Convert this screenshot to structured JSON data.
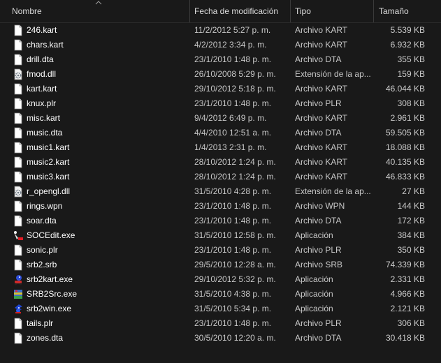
{
  "columns": {
    "name": "Nombre",
    "date": "Fecha de modificación",
    "type": "Tipo",
    "size": "Tamaño"
  },
  "files": [
    {
      "name": "246.kart",
      "date": "11/2/2012 5:27 p. m.",
      "type": "Archivo KART",
      "size": "5.539 KB",
      "icon": "document-icon"
    },
    {
      "name": "chars.kart",
      "date": "4/2/2012 3:34 p. m.",
      "type": "Archivo KART",
      "size": "6.932 KB",
      "icon": "document-icon"
    },
    {
      "name": "drill.dta",
      "date": "23/1/2010 1:48 p. m.",
      "type": "Archivo DTA",
      "size": "355 KB",
      "icon": "document-icon"
    },
    {
      "name": "fmod.dll",
      "date": "26/10/2008 5:29 p. m.",
      "type": "Extensión de la ap...",
      "size": "159 KB",
      "icon": "dll-gear-icon"
    },
    {
      "name": "kart.kart",
      "date": "29/10/2012 5:18 p. m.",
      "type": "Archivo KART",
      "size": "46.044 KB",
      "icon": "document-icon"
    },
    {
      "name": "knux.plr",
      "date": "23/1/2010 1:48 p. m.",
      "type": "Archivo PLR",
      "size": "308 KB",
      "icon": "document-icon"
    },
    {
      "name": "misc.kart",
      "date": "9/4/2012 6:49 p. m.",
      "type": "Archivo KART",
      "size": "2.961 KB",
      "icon": "document-icon"
    },
    {
      "name": "music.dta",
      "date": "4/4/2010 12:51 a. m.",
      "type": "Archivo DTA",
      "size": "59.505 KB",
      "icon": "document-icon"
    },
    {
      "name": "music1.kart",
      "date": "1/4/2013 2:31 p. m.",
      "type": "Archivo KART",
      "size": "18.088 KB",
      "icon": "document-icon"
    },
    {
      "name": "music2.kart",
      "date": "28/10/2012 1:24 p. m.",
      "type": "Archivo KART",
      "size": "40.135 KB",
      "icon": "document-icon"
    },
    {
      "name": "music3.kart",
      "date": "28/10/2012 1:24 p. m.",
      "type": "Archivo KART",
      "size": "46.833 KB",
      "icon": "document-icon"
    },
    {
      "name": "r_opengl.dll",
      "date": "31/5/2010 4:28 p. m.",
      "type": "Extensión de la ap...",
      "size": "27 KB",
      "icon": "dll-gear-icon"
    },
    {
      "name": "rings.wpn",
      "date": "23/1/2010 1:48 p. m.",
      "type": "Archivo WPN",
      "size": "144 KB",
      "icon": "document-icon"
    },
    {
      "name": "soar.dta",
      "date": "23/1/2010 1:48 p. m.",
      "type": "Archivo DTA",
      "size": "172 KB",
      "icon": "document-icon"
    },
    {
      "name": "SOCEdit.exe",
      "date": "31/5/2010 12:58 p. m.",
      "type": "Aplicación",
      "size": "384 KB",
      "icon": "socedit-app-icon"
    },
    {
      "name": "sonic.plr",
      "date": "23/1/2010 1:48 p. m.",
      "type": "Archivo PLR",
      "size": "350 KB",
      "icon": "document-icon"
    },
    {
      "name": "srb2.srb",
      "date": "29/5/2010 12:28 a. m.",
      "type": "Archivo SRB",
      "size": "74.339 KB",
      "icon": "document-icon"
    },
    {
      "name": "srb2kart.exe",
      "date": "29/10/2012 5:32 p. m.",
      "type": "Aplicación",
      "size": "2.331 KB",
      "icon": "srb2kart-app-icon"
    },
    {
      "name": "SRB2Src.exe",
      "date": "31/5/2010 4:38 p. m.",
      "type": "Aplicación",
      "size": "4.966 KB",
      "icon": "srb2src-app-icon"
    },
    {
      "name": "srb2win.exe",
      "date": "31/5/2010 5:34 p. m.",
      "type": "Aplicación",
      "size": "2.121 KB",
      "icon": "srb2win-app-icon"
    },
    {
      "name": "tails.plr",
      "date": "23/1/2010 1:48 p. m.",
      "type": "Archivo PLR",
      "size": "306 KB",
      "icon": "document-icon"
    },
    {
      "name": "zones.dta",
      "date": "30/5/2010 12:20 a. m.",
      "type": "Archivo DTA",
      "size": "30.418 KB",
      "icon": "document-icon"
    }
  ],
  "colors": {
    "background": "#191919",
    "name_text": "#ffffff",
    "detail_text": "#c8c8c8",
    "separator": "#3a3a3a"
  }
}
